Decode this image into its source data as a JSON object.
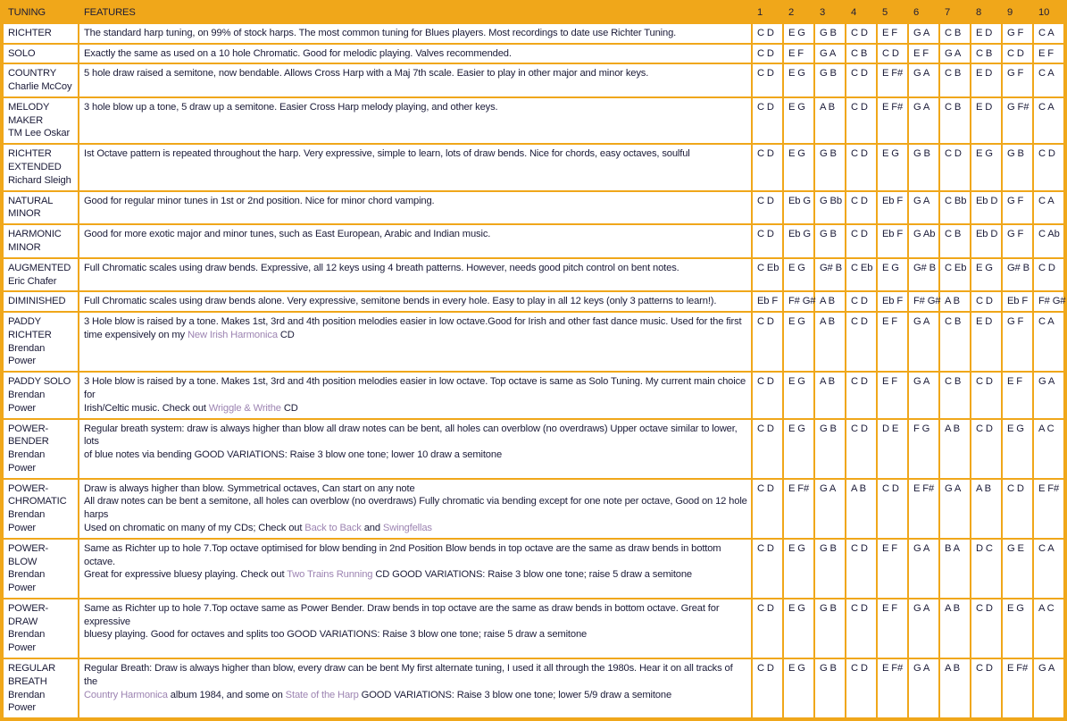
{
  "table": {
    "headers": {
      "tuning": "TUNING",
      "features": "FEATURES",
      "holes": [
        "1",
        "2",
        "3",
        "4",
        "5",
        "6",
        "7",
        "8",
        "9",
        "10"
      ]
    },
    "colors": {
      "grid": "#F0A71A",
      "header_text": "#1a1a1a",
      "body_text": "#1b1b38",
      "link": "#9d84b2",
      "cell_background": "#ffffff"
    },
    "rows": [
      {
        "name_lines": [
          "RICHTER"
        ],
        "features": [
          {
            "segments": [
              {
                "text": "The standard harp tuning, on 99% of stock harps. The most common tuning for Blues players. Most recordings to date use Richter Tuning.",
                "link": false
              }
            ]
          }
        ],
        "notes": [
          "C D",
          "E G",
          "G B",
          "C D",
          "E F",
          "G A",
          "C B",
          "E D",
          "G F",
          "C A"
        ]
      },
      {
        "name_lines": [
          "SOLO"
        ],
        "features": [
          {
            "segments": [
              {
                "text": "Exactly the same as used on a 10 hole Chromatic. Good for melodic playing. Valves recommended.",
                "link": false
              }
            ]
          }
        ],
        "notes": [
          "C D",
          "E F",
          "G A",
          "C B",
          "C D",
          "E F",
          "G A",
          "C B",
          "C D",
          "E F"
        ]
      },
      {
        "name_lines": [
          "COUNTRY",
          "Charlie McCoy"
        ],
        "features": [
          {
            "segments": [
              {
                "text": "5 hole draw raised a semitone, now bendable. Allows Cross Harp with a Maj 7th scale. Easier to play in other major and minor keys.",
                "link": false
              }
            ]
          }
        ],
        "notes": [
          "C D",
          "E G",
          "G B",
          "C D",
          "E F#",
          "G A",
          "C B",
          "E D",
          "G F",
          "C A"
        ]
      },
      {
        "name_lines": [
          "MELODY",
          "MAKER",
          "TM Lee Oskar"
        ],
        "features": [
          {
            "segments": [
              {
                "text": "3 hole blow up a tone, 5 draw up a semitone. Easier Cross Harp melody playing, and other keys.",
                "link": false
              }
            ]
          }
        ],
        "notes": [
          "C D",
          "E G",
          "A B",
          "C D",
          "E F#",
          "G A",
          "C B",
          "E D",
          "G F#",
          "C A"
        ]
      },
      {
        "name_lines": [
          "RICHTER",
          "EXTENDED",
          "Richard Sleigh"
        ],
        "features": [
          {
            "segments": [
              {
                "text": "Ist Octave pattern is repeated throughout the harp. Very expressive, simple to learn, lots of draw bends. Nice for chords, easy octaves, soulful",
                "link": false
              }
            ]
          }
        ],
        "notes": [
          "C D",
          "E G",
          "G B",
          "C D",
          "E G",
          "G B",
          "C D",
          "E G",
          "G B",
          "C D"
        ]
      },
      {
        "name_lines": [
          "NATURAL",
          "MINOR"
        ],
        "features": [
          {
            "segments": [
              {
                "text": "Good for regular minor tunes in 1st or 2nd position. Nice for minor chord vamping.",
                "link": false
              }
            ]
          }
        ],
        "notes": [
          "C D",
          "Eb G",
          "G Bb",
          "C D",
          "Eb F",
          "G A",
          "C Bb",
          "Eb D",
          "G F",
          "C A"
        ]
      },
      {
        "name_lines": [
          "HARMONIC",
          "MINOR"
        ],
        "features": [
          {
            "segments": [
              {
                "text": "Good for more exotic major and minor tunes, such as East European, Arabic and Indian music.",
                "link": false
              }
            ]
          }
        ],
        "notes": [
          "C D",
          "Eb G",
          "G B",
          "C D",
          "Eb F",
          "G Ab",
          "C B",
          "Eb D",
          "G F",
          "C Ab"
        ]
      },
      {
        "name_lines": [
          "AUGMENTED",
          "Eric Chafer"
        ],
        "features": [
          {
            "segments": [
              {
                "text": "Full Chromatic scales using draw bends. Expressive, all 12 keys using 4 breath patterns. However, needs good pitch control on bent notes.",
                "link": false
              }
            ]
          }
        ],
        "notes": [
          "C Eb",
          "E G",
          "G# B",
          "C Eb",
          "E G",
          "G# B",
          "C Eb",
          "E G",
          "G# B",
          "C D"
        ]
      },
      {
        "name_lines": [
          "DIMINISHED"
        ],
        "features": [
          {
            "segments": [
              {
                "text": "Full Chromatic scales using draw bends alone. Very expressive, semitone bends in every hole. Easy to play in all 12 keys (only 3 patterns to learn!).",
                "link": false
              }
            ]
          }
        ],
        "notes": [
          "Eb F",
          "F# G#",
          "A B",
          "C D",
          "Eb F",
          "F# G#",
          "A B",
          "C D",
          "Eb F",
          "F# G#"
        ]
      },
      {
        "name_lines": [
          "PADDY",
          "RICHTER",
          "Brendan Power"
        ],
        "features": [
          {
            "segments": [
              {
                "text": "3 Hole blow is raised by a tone. Makes 1st, 3rd and 4th position melodies easier in low octave.Good for Irish and other fast dance music. Used for the first",
                "link": false
              }
            ]
          },
          {
            "segments": [
              {
                "text": "time expensively on my ",
                "link": false
              },
              {
                "text": "New Irish Harmonica",
                "link": true
              },
              {
                "text": " CD",
                "link": false
              }
            ]
          }
        ],
        "notes": [
          "C D",
          "E G",
          "A B",
          "C D",
          "E F",
          "G A",
          "C B",
          "E D",
          "G F",
          "C A"
        ]
      },
      {
        "name_lines": [
          "PADDY SOLO",
          "Brendan Power"
        ],
        "features": [
          {
            "segments": [
              {
                "text": "3 Hole blow is raised by a tone. Makes 1st, 3rd and 4th position melodies easier in low octave. Top octave is same as Solo Tuning. My current main choice for",
                "link": false
              }
            ]
          },
          {
            "segments": [
              {
                "text": "Irish/Celtic music. Check out ",
                "link": false
              },
              {
                "text": "Wriggle & Writhe",
                "link": true
              },
              {
                "text": " CD",
                "link": false
              }
            ]
          }
        ],
        "notes": [
          "C D",
          "E G",
          "A B",
          "C D",
          "E F",
          "G A",
          "C B",
          "C D",
          "E F",
          "G A"
        ]
      },
      {
        "name_lines": [
          "POWER-",
          "BENDER",
          "Brendan Power"
        ],
        "features": [
          {
            "segments": [
              {
                "text": "Regular breath system: draw is always higher than blow all draw notes can be bent, all holes can overblow (no overdraws) Upper octave similar to lower, lots",
                "link": false
              }
            ]
          },
          {
            "segments": [
              {
                "text": "of blue notes via bending GOOD VARIATIONS: Raise 3 blow one tone; lower 10 draw a semitone",
                "link": false
              }
            ]
          }
        ],
        "notes": [
          "C D",
          "E G",
          "G B",
          "C D",
          "D E",
          "F G",
          "A B",
          "C D",
          "E G",
          "A C"
        ]
      },
      {
        "name_lines": [
          "POWER-",
          "CHROMATIC",
          "Brendan Power"
        ],
        "features": [
          {
            "segments": [
              {
                "text": "Draw is always higher than blow. Symmetrical octaves, Can start on any note",
                "link": false
              }
            ]
          },
          {
            "segments": [
              {
                "text": "All draw notes can be bent a semitone, all holes can overblow (no overdraws) Fully chromatic via bending except for one note per octave, Good on 12 hole",
                "link": false
              }
            ]
          },
          {
            "segments": [
              {
                "text": "harps",
                "link": false
              }
            ]
          },
          {
            "segments": [
              {
                "text": "Used on chromatic on many of my CDs; Check out ",
                "link": false
              },
              {
                "text": "Back to Back",
                "link": true
              },
              {
                "text": " and ",
                "link": false
              },
              {
                "text": "Swingfellas",
                "link": true
              }
            ]
          }
        ],
        "notes": [
          "C D",
          "E F#",
          "G A",
          "A B",
          "C D",
          "E F#",
          "G A",
          "A B",
          "C D",
          "E F#"
        ]
      },
      {
        "name_lines": [
          "POWER-BLOW",
          "Brendan Power"
        ],
        "features": [
          {
            "segments": [
              {
                "text": "Same as Richter up to hole 7.Top octave optimised for blow bending in 2nd Position Blow bends in top octave are the same as draw bends in bottom octave.",
                "link": false
              }
            ]
          },
          {
            "segments": [
              {
                "text": "Great for expressive bluesy playing. Check out ",
                "link": false
              },
              {
                "text": "Two Trains Running",
                "link": true
              },
              {
                "text": " CD GOOD VARIATIONS: Raise 3 blow one tone; raise 5 draw a semitone",
                "link": false
              }
            ]
          }
        ],
        "notes": [
          "C D",
          "E G",
          "G B",
          "C D",
          "E F",
          "G A",
          "B A",
          "D C",
          "G E",
          "C A"
        ]
      },
      {
        "name_lines": [
          "POWER-DRAW",
          "Brendan Power"
        ],
        "features": [
          {
            "segments": [
              {
                "text": "Same as Richter up to hole 7.Top octave same as Power Bender. Draw bends in top octave are the same as draw bends in bottom octave. Great for expressive",
                "link": false
              }
            ]
          },
          {
            "segments": [
              {
                "text": "bluesy playing. Good for octaves and splits too GOOD VARIATIONS: Raise 3 blow one tone; raise 5 draw a semitone",
                "link": false
              }
            ]
          }
        ],
        "notes": [
          "C D",
          "E G",
          "G B",
          "C D",
          "E F",
          "G A",
          "A B",
          "C D",
          "E G",
          "A C"
        ]
      },
      {
        "name_lines": [
          "REGULAR",
          "BREATH",
          "Brendan Power"
        ],
        "features": [
          {
            "segments": [
              {
                "text": "Regular Breath: Draw is always higher than blow, every draw can be bent My first alternate tuning, I used it all through the 1980s. Hear it on all tracks of the",
                "link": false
              }
            ]
          },
          {
            "segments": [
              {
                "text": "",
                "link": false
              },
              {
                "text": "Country Harmonica",
                "link": true
              },
              {
                "text": " album 1984, and some on ",
                "link": false
              },
              {
                "text": "State of the Harp",
                "link": true
              },
              {
                "text": " GOOD VARIATIONS: Raise 3 blow one tone; lower 5/9 draw a semitone",
                "link": false
              }
            ]
          }
        ],
        "notes": [
          "C D",
          "E G",
          "G B",
          "C D",
          "E F#",
          "G A",
          "A B",
          "C D",
          "E F#",
          "G A"
        ]
      }
    ]
  }
}
